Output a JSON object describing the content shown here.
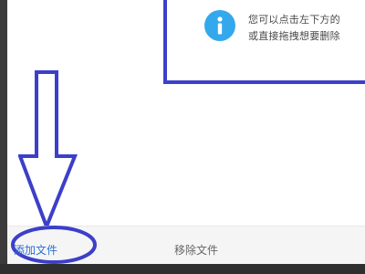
{
  "tip": {
    "icon": "info-icon",
    "line1": "您可以点击左下方的",
    "line2": "或直接拖拽想要删除"
  },
  "footer": {
    "add_file_label": "添加文件",
    "remove_file_label": "移除文件"
  },
  "colors": {
    "annotation": "#3c3fc9",
    "info_icon": "#34a8ec",
    "link": "#2f6fd6"
  }
}
